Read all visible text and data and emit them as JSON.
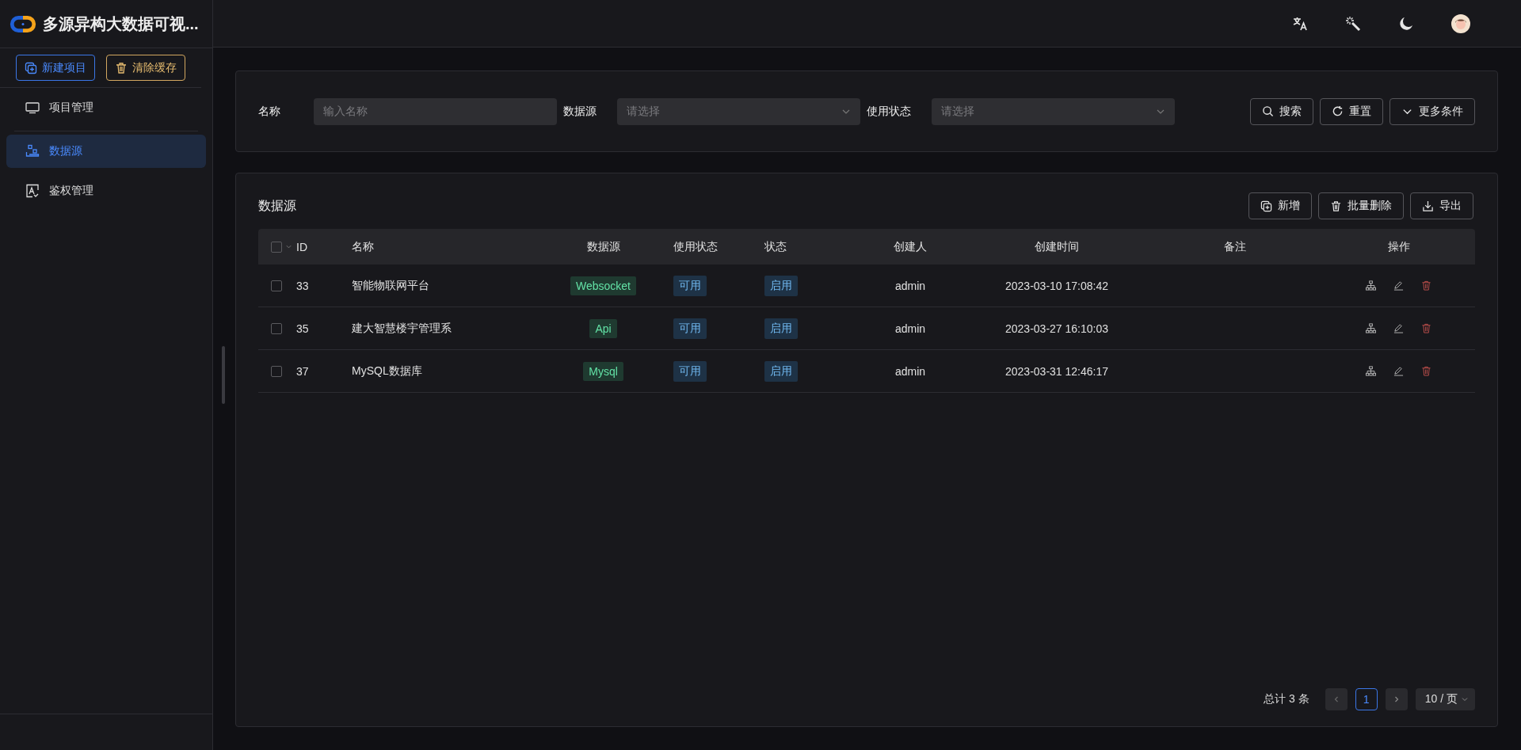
{
  "app": {
    "title": "多源异构大数据可视..."
  },
  "sidebar": {
    "buttons": [
      {
        "label": "新建项目",
        "kind": "primary"
      },
      {
        "label": "清除缓存",
        "kind": "warning"
      }
    ],
    "items": [
      {
        "label": "项目管理",
        "selected": false
      },
      {
        "label": "数据源",
        "selected": true
      },
      {
        "label": "鉴权管理",
        "selected": false
      }
    ]
  },
  "filter": {
    "fields": [
      {
        "label": "名称",
        "kind": "input",
        "placeholder": "输入名称"
      },
      {
        "label": "数据源",
        "kind": "select",
        "placeholder": "请选择"
      },
      {
        "label": "使用状态",
        "kind": "select",
        "placeholder": "请选择"
      }
    ],
    "buttons": [
      {
        "label": "搜索"
      },
      {
        "label": "重置"
      },
      {
        "label": "更多条件"
      }
    ]
  },
  "table": {
    "title": "数据源",
    "actions": [
      {
        "label": "新增"
      },
      {
        "label": "批量删除"
      },
      {
        "label": "导出"
      }
    ],
    "columns": [
      "ID",
      "名称",
      "数据源",
      "使用状态",
      "状态",
      "创建人",
      "创建时间",
      "备注",
      "操作"
    ],
    "header_checked": false,
    "rows": [
      {
        "checked": false,
        "id": "33",
        "name": "智能物联网平台",
        "source": "Websocket",
        "usage": "可用",
        "status": "启用",
        "creator": "admin",
        "created": "2023-03-10 17:08:42"
      },
      {
        "checked": false,
        "id": "35",
        "name": "建大智慧楼宇管理系",
        "source": "Api",
        "usage": "可用",
        "status": "启用",
        "creator": "admin",
        "created": "2023-03-27 16:10:03"
      },
      {
        "checked": false,
        "id": "37",
        "name": "MySQL数据库",
        "source": "Mysql",
        "usage": "可用",
        "status": "启用",
        "creator": "admin",
        "created": "2023-03-31 12:46:17"
      }
    ]
  },
  "pagination": {
    "total": "总计 3 条",
    "pages": [
      {
        "label": "1",
        "selected": true
      }
    ],
    "page_size": "10 / 页"
  }
}
